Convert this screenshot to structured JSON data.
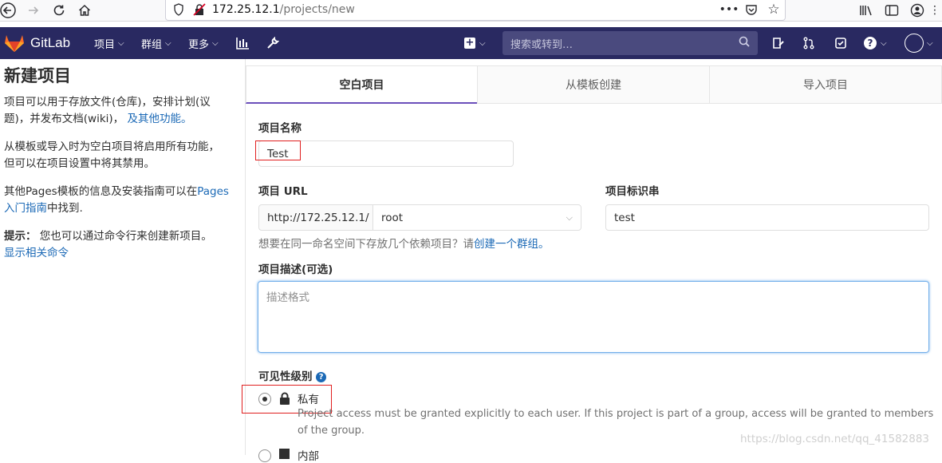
{
  "browser": {
    "url_host": "172.25.12.1",
    "url_path": "/projects/new"
  },
  "nav": {
    "brand": "GitLab",
    "menu_projects": "项目",
    "menu_groups": "群组",
    "menu_more": "更多",
    "search_placeholder": "搜索或转到…"
  },
  "sidebar": {
    "title": "新建项目",
    "p1_text": "项目可以用于存放文件(仓库)，安排计划(议题)，并发布文档(wiki)，",
    "p1_link": "及其他功能。",
    "p2_text": "从模板或导入时为空白项目将启用所有功能，但可以在项目设置中将其禁用。",
    "p3_text": "其他Pages模板的信息及安装指南可以在",
    "p3_link": "Pages 入门指南",
    "p3_tail": "中找到.",
    "p4_label": "提示：",
    "p4_text": "您也可以通过命令行来创建新项目。",
    "p4_link": "显示相关命令"
  },
  "tabs": [
    {
      "label": "空白项目",
      "active": true
    },
    {
      "label": "从模板创建",
      "active": false
    },
    {
      "label": "导入项目",
      "active": false
    }
  ],
  "form": {
    "name_label": "项目名称",
    "name_value": "Test",
    "url_label": "项目 URL",
    "url_prefix": "http://172.25.12.1/",
    "namespace_value": "root",
    "slug_label": "项目标识串",
    "slug_value": "test",
    "group_help": "想要在同一命名空间下存放几个依赖项目？请",
    "group_help_link": "创建一个群组。",
    "desc_label": "项目描述(可选)",
    "desc_placeholder": "描述格式",
    "visibility_label": "可见性级别",
    "private_label": "私有",
    "private_desc": "Project access must be granted explicitly to each user. If this project is part of a group, access will be granted to members of the group.",
    "internal_label": "内部"
  },
  "watermark": "https://blog.csdn.net/qq_41582883",
  "colors": {
    "nav_bg": "#292961",
    "link": "#1b69b6",
    "tab_active_border": "#6b4fbb",
    "annotation": "#e02020"
  }
}
